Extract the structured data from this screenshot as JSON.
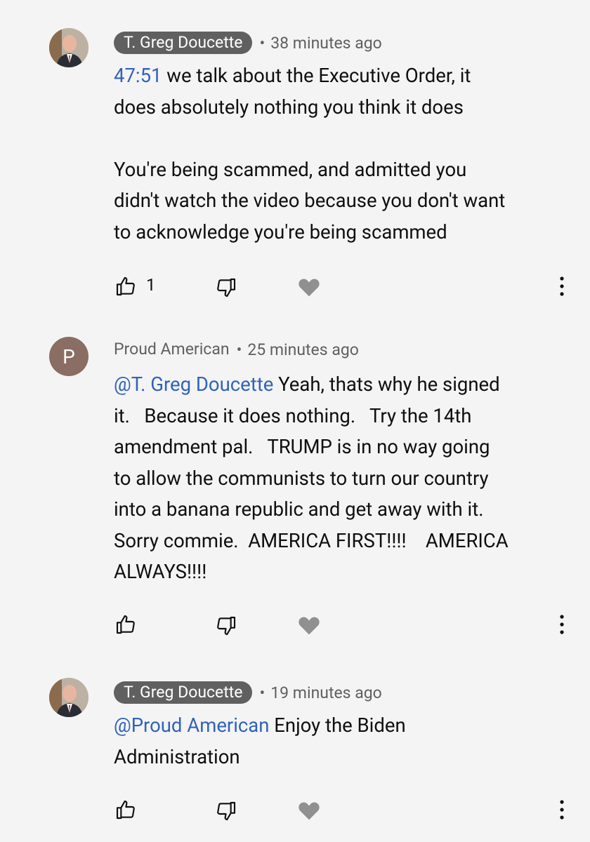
{
  "comments": [
    {
      "author": "T. Greg Doucette",
      "author_style": "chip",
      "separator": "•",
      "time": "38 minutes ago",
      "timestamp_link": "47:51",
      "text_after_link": " we talk about the Executive Order, it\ndoes absolutely nothing you think it does\n\nYou're being scammed, and admitted you\ndidn't watch the video because you don't want\nto acknowledge you're being scammed",
      "like_count": "1",
      "avatar_icon": "profile-photo"
    },
    {
      "author": "Proud American",
      "author_style": "plain",
      "separator": "•",
      "time": "25 minutes ago",
      "avatar_letter": "P",
      "mention": "@T. Greg Doucette",
      "text_after_link": " Yeah, thats why he signed\nit.   Because it does nothing.   Try the 14th\namendment pal.   TRUMP is in no way going\nto allow the communists to turn our country\ninto a banana republic and get away with it.\nSorry commie.  AMERICA FIRST!!!!    AMERICA\nALWAYS!!!!",
      "like_count": ""
    },
    {
      "author": "T. Greg Doucette",
      "author_style": "chip",
      "separator": "•",
      "time": "19 minutes ago",
      "mention": "@Proud American",
      "text_after_link": " Enjoy the Biden\nAdministration",
      "like_count": "",
      "avatar_icon": "profile-photo"
    }
  ],
  "icons": {
    "like": "thumbs-up-icon",
    "dislike": "thumbs-down-icon",
    "heart": "heart-icon",
    "more": "more-vert-icon"
  },
  "colors": {
    "background": "#f4f4f4",
    "link": "#3063b8",
    "chip": "#606060",
    "meta": "#606060",
    "avatar_letter_bg": "#8a6e63"
  }
}
